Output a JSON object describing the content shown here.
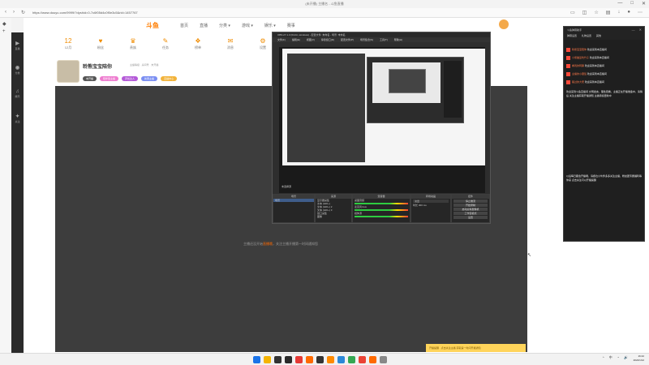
{
  "browser": {
    "title": "(未开播) 主播名 - 斗鱼直播",
    "url": "https://www.douyu.com/9999/?dyshid=0-7c6f05d4c0f0e3c5&rid=1457767",
    "window_controls": [
      "—",
      "□",
      "✕"
    ],
    "nav_icons": [
      "back-icon",
      "forward-icon",
      "refresh-icon"
    ],
    "tool_icons": [
      "tab-icon",
      "extension-icon",
      "star-icon",
      "collection-icon",
      "download-icon",
      "profile-icon",
      "menu-icon"
    ]
  },
  "leftrail": {
    "icons": [
      "douyu-icon",
      "plus-icon"
    ]
  },
  "sidenav": {
    "items": [
      {
        "icon": "▶",
        "label": "直播"
      },
      {
        "icon": "◉",
        "label": "分类"
      },
      {
        "icon": "♫",
        "label": "娱乐"
      },
      {
        "icon": "✦",
        "label": "关注"
      }
    ]
  },
  "site": {
    "logo": "斗鱼",
    "nav": [
      "首页",
      "直播",
      "分类 ▾",
      "游戏 ▾",
      "娱乐 ▾",
      "赛事"
    ]
  },
  "categories": [
    {
      "icon": "12",
      "label": "12月"
    },
    {
      "icon": "♥",
      "label": "粉丝"
    },
    {
      "icon": "♛",
      "label": "贵族"
    },
    {
      "icon": "✎",
      "label": "任务"
    },
    {
      "icon": "❖",
      "label": "榜单"
    },
    {
      "icon": "✉",
      "label": "消息"
    },
    {
      "icon": "⚙",
      "label": "设置"
    },
    {
      "icon": "♪",
      "label": "音乐"
    },
    {
      "icon": "★",
      "label": "活动"
    },
    {
      "icon": "◎",
      "label": "历史"
    },
    {
      "icon": "☰",
      "label": "更多"
    }
  ],
  "streamer": {
    "name": "聆熊宝宝陪你",
    "meta": "主播等级 · 房间号 · 未开播",
    "tags": [
      {
        "text": "未开播",
        "color": "#555555"
      },
      {
        "text": "陪伴型主播",
        "color": "#ee7ccf"
      },
      {
        "text": "声优达人",
        "color": "#b45ad8"
      },
      {
        "text": "新晋主播",
        "color": "#7a8ef2"
      },
      {
        "text": "直播中心",
        "color": "#f2b33a"
      }
    ]
  },
  "player": {
    "offline_hint_prefix": "主播还没开始",
    "offline_hint_link": "直播哦",
    "offline_hint_suffix": "，关注主播开播第一时间通知您"
  },
  "bottom_banner": {
    "text": "开播提醒 · 点击关注主播 获取第一时间开播通知"
  },
  "obs": {
    "title": "OBS 27.1.3 (64-bit, windows) - 配置文件: 未命名 - 场景: 未命名",
    "menu": [
      "文件(F)",
      "编辑(E)",
      "视图(V)",
      "停靠窗口(D)",
      "配置文件(P)",
      "场景集合(S)",
      "工具(T)",
      "帮助(H)"
    ],
    "scene_label": "未选择源",
    "docks": {
      "scenes": {
        "header": "场景",
        "items": [
          "场景"
        ]
      },
      "sources": {
        "header": "来源",
        "items": [
          "显示器采集",
          "文本 (GDI+)",
          "文本 (GDI+) 2",
          "文本 (GDI+) 3",
          "窗口采集",
          "图像"
        ]
      },
      "mixer": {
        "header": "混音器",
        "items": [
          "桌面音频",
          "麦克风/Aux",
          "媒体源"
        ]
      },
      "transitions": {
        "header": "转场动画",
        "fade": "淡出",
        "duration_label": "时长",
        "duration": "300 ms"
      },
      "controls": {
        "header": "控件",
        "buttons": [
          "停止推流",
          "开始录制",
          "启动虚拟摄像机",
          "工作室模式",
          "设置",
          "退出"
        ]
      }
    }
  },
  "danmaku": {
    "title": "斗鱼弹幕助手",
    "window_controls": [
      "—",
      "✕"
    ],
    "tabs": [
      "弹幕设置",
      "礼物设置",
      "其他"
    ],
    "messages": [
      {
        "user": "聆熊宝宝陪你",
        "text": "欢迎来到本直播间"
      },
      {
        "user": "小熊猫爱吃竹子",
        "text": "欢迎来到本直播间"
      },
      {
        "user": "看戏的阿飘",
        "text": "欢迎来到本直播间"
      },
      {
        "user": "主播的小跟班",
        "text": "欢迎来到本直播间"
      },
      {
        "user": "路过的大佬",
        "text": "欢迎来到本直播间"
      }
    ],
    "notice_1": "欢迎来到斗鱼直播间 文明发言，理性观看，主播正在开播准备中，请稍后 关注主播获取开播通知 主播持续更新中",
    "notice_2": "以后每日都会开播哦，请各位小伙伴多多关注主播，粉丝团专属福利等你来 点击关注可以开播提醒"
  },
  "taskbar": {
    "apps": [
      "#1a73e8",
      "#f5b400",
      "#333333",
      "#2a2a2a",
      "#e53935",
      "#ff6a00",
      "#333333",
      "#ff8a00",
      "#2b88d8",
      "#34a853",
      "#ea4335",
      "#ff6a00",
      "#888888"
    ],
    "tray": [
      "^",
      "中",
      "◔",
      "🔊"
    ],
    "time": "16:42",
    "date": "2022/1/12"
  }
}
